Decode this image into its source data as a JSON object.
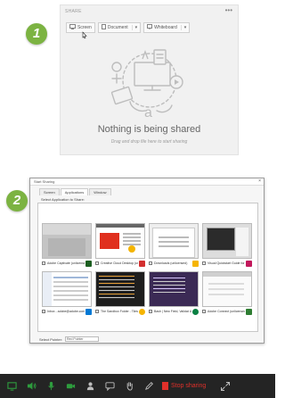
{
  "steps": [
    "1",
    "2"
  ],
  "share_pod": {
    "title": "SHARE",
    "menu": "•••",
    "buttons": [
      {
        "label": "Screen",
        "icon": "monitor-icon"
      },
      {
        "label": "Document",
        "icon": "document-icon"
      },
      {
        "label": "Whiteboard",
        "icon": "whiteboard-icon"
      }
    ],
    "caret": "▾",
    "empty_title": "Nothing is being shared",
    "empty_subtitle": "Drag and drop file here to start sharing"
  },
  "dialog": {
    "title": "Start Sharing",
    "close": "×",
    "tabs": [
      "Screen",
      "Applications",
      "Window"
    ],
    "active_tab": "Applications",
    "instruction": "Select Application to Share:",
    "thumbnails": [
      {
        "label": "Adobe Captivate (unlicensed)",
        "icon_color": "#1b5e20"
      },
      {
        "label": "Creative Cloud Desktop (unlicensed)",
        "icon_color": "#d32f2f"
      },
      {
        "label": "Downloads (unlicensed)",
        "icon_color": "#f5b400"
      },
      {
        "label": "Visual Quickstart Guide for FrameMaker",
        "icon_color": "#c2185b"
      },
      {
        "label": "Inbox - adobe@adobe.com",
        "icon_color": "#0078d4"
      },
      {
        "label": "The Sandbox Folder - Tilesh",
        "icon_color": "#f5b400"
      },
      {
        "label": "Bash | New Field, Validat Up...",
        "icon_color": "#0b8043"
      },
      {
        "label": "Adobe Connect (unlicensed)",
        "icon_color": "#2e7d32"
      }
    ],
    "bottom_label": "Select Pointer:",
    "bottom_value": "Red Pointer"
  },
  "toolbar": {
    "icons": [
      "share-screen-icon",
      "speaker-icon",
      "microphone-icon",
      "camera-icon",
      "attendees-icon",
      "chat-icon",
      "raise-hand-icon",
      "pen-icon"
    ],
    "stop_label": "Stop sharing",
    "accent": "#2e9d3e",
    "stop_color": "#e0302a"
  }
}
